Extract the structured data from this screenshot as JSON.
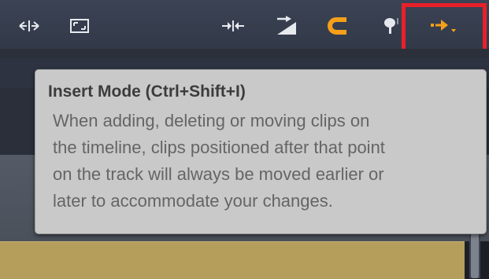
{
  "toolbar": {
    "buttons": [
      {
        "name": "split-view-button",
        "icon": "arrows-split-icon"
      },
      {
        "name": "fit-to-window-button",
        "icon": "expand-frame-icon"
      },
      {
        "name": "snap-edges-button",
        "icon": "arrows-inward-icon"
      },
      {
        "name": "ripple-button",
        "icon": "arrow-ramp-icon"
      },
      {
        "name": "magnet-button",
        "icon": "magnet-icon"
      },
      {
        "name": "audio-scrub-button",
        "icon": "pin-icon"
      },
      {
        "name": "insert-mode-button",
        "icon": "insert-arrow-icon"
      }
    ],
    "accent_color": "#f5a01a",
    "highlight_color": "#e8202a"
  },
  "tooltip": {
    "title": "Insert Mode (Ctrl+Shift+I)",
    "lines": [
      "When adding, deleting or moving clips on",
      "the timeline, clips positioned after that point",
      "on the track will always be moved earlier or",
      "later to accommodate your changes."
    ]
  }
}
